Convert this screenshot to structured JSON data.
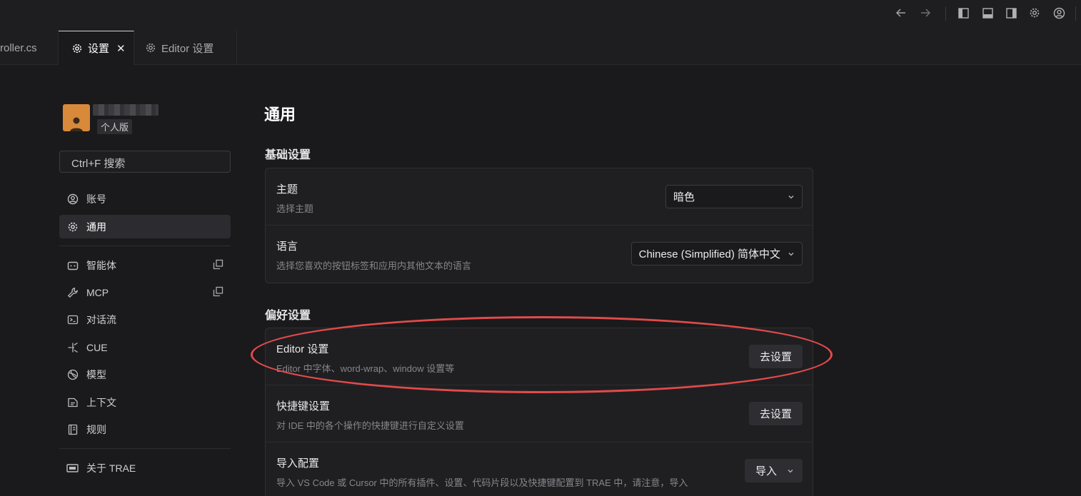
{
  "titlebar": {
    "icons": [
      "back-arrow-icon",
      "forward-arrow-icon",
      "toggle-left-panel-icon",
      "toggle-bottom-panel-icon",
      "toggle-right-panel-icon",
      "settings-gear-icon",
      "account-icon"
    ]
  },
  "tabs": [
    {
      "label": "roller.cs"
    },
    {
      "label": "设置",
      "close": "✕"
    },
    {
      "label": "Editor 设置"
    }
  ],
  "profile": {
    "edition": "个人版"
  },
  "search": {
    "placeholder": "Ctrl+F 搜索"
  },
  "sidebar": {
    "items": [
      {
        "label": "账号",
        "icon": "user-circle-icon"
      },
      {
        "label": "通用",
        "icon": "gear-icon"
      },
      {
        "label": "智能体",
        "icon": "bot-icon"
      },
      {
        "label": "MCP",
        "icon": "wrench-icon"
      },
      {
        "label": "对话流",
        "icon": "terminal-icon"
      },
      {
        "label": "CUE",
        "icon": "cue-icon"
      },
      {
        "label": "模型",
        "icon": "model-icon"
      },
      {
        "label": "上下文",
        "icon": "context-icon"
      },
      {
        "label": "规则",
        "icon": "rules-icon"
      },
      {
        "label": "关于 TRAE",
        "icon": "about-icon"
      }
    ]
  },
  "content": {
    "title": "通用",
    "basic": {
      "heading": "基础设置",
      "theme": {
        "title": "主题",
        "desc": "选择主题",
        "value": "暗色"
      },
      "language": {
        "title": "语言",
        "desc": "选择您喜欢的按钮标签和应用内其他文本的语言",
        "value": "Chinese (Simplified) 简体中文"
      }
    },
    "prefs": {
      "heading": "偏好设置",
      "editor": {
        "title": "Editor 设置",
        "desc": "Editor 中字体、word-wrap、window 设置等",
        "button": "去设置"
      },
      "shortcut": {
        "title": "快捷键设置",
        "desc": "对 IDE 中的各个操作的快捷键进行自定义设置",
        "button": "去设置"
      },
      "import": {
        "title": "导入配置",
        "desc": "导入 VS Code 或 Cursor 中的所有插件、设置、代码片段以及快捷键配置到 TRAE 中，请注意，导入",
        "button": "导入"
      }
    }
  },
  "colors": {
    "accent_highlight": "#e24a4a",
    "avatar": "#d9893a"
  }
}
